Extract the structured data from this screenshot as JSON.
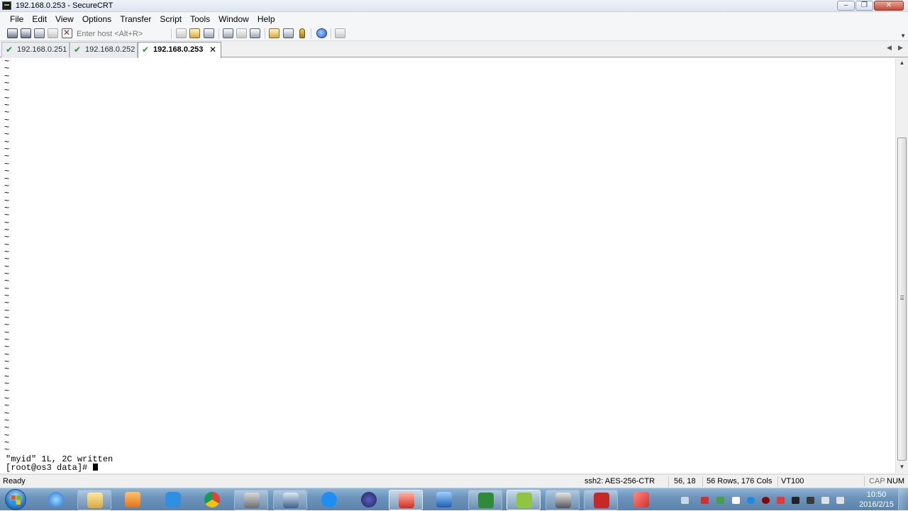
{
  "window": {
    "title": "192.168.0.253 - SecureCRT",
    "minimize_glyph": "–",
    "maximize_glyph": "❐",
    "close_glyph": "✕"
  },
  "menu": [
    "File",
    "Edit",
    "View",
    "Options",
    "Transfer",
    "Script",
    "Tools",
    "Window",
    "Help"
  ],
  "toolbar": {
    "host_placeholder": "Enter host <Alt+R>",
    "icons": [
      "connect-icon",
      "quick-connect-icon",
      "connect-in-tab-icon",
      "reconnect-icon",
      "disconnect-icon",
      "copy-icon",
      "paste-icon",
      "find-icon",
      "print-icon",
      "print-selection-icon",
      "print-setup-icon",
      "session-options-icon",
      "global-options-icon",
      "keymap-icon",
      "help-icon",
      "sftp-icon"
    ]
  },
  "tabs": [
    {
      "label": "192.168.0.251",
      "connected": true,
      "active": false
    },
    {
      "label": "192.168.0.252",
      "connected": true,
      "active": false
    },
    {
      "label": "192.168.0.253",
      "connected": true,
      "active": true
    }
  ],
  "tab_icons": {
    "check": "✔",
    "close": "✕",
    "scroll_left": "◀",
    "scroll_right": "▶"
  },
  "terminal": {
    "tilde_char": "~",
    "tilde_count": 54,
    "lines": [
      "\"myid\" 1L, 2C written",
      "[root@os3 data]# "
    ]
  },
  "scrollbar": {
    "up": "▲",
    "down": "▼"
  },
  "status": {
    "state": "Ready",
    "encryption": "ssh2: AES-256-CTR",
    "cursor": "56,  18",
    "size": "56 Rows, 176 Cols",
    "emulation": "VT100",
    "caps": "CAP",
    "num": "NUM"
  },
  "taskbar": {
    "apps": [
      "start-button",
      "internet-explorer-icon",
      "file-explorer-icon",
      "media-player-icon",
      "baidu-cloud-icon",
      "chrome-icon",
      "app-icon",
      "network-app-icon",
      "pen-app-icon",
      "eclipse-icon",
      "red-app-icon",
      "virtualbox-icon",
      "project-app-icon",
      "m-app-icon",
      "securecrt-taskbar-icon",
      "pdf-app-icon",
      "note-app-icon"
    ],
    "time": "10:50",
    "date": "2016/2/15"
  },
  "colors": {
    "terminal_bg": "#ffffff",
    "terminal_fg": "#000000",
    "tab_check": "#1f9a2b",
    "taskbar": "#6d95bb"
  }
}
